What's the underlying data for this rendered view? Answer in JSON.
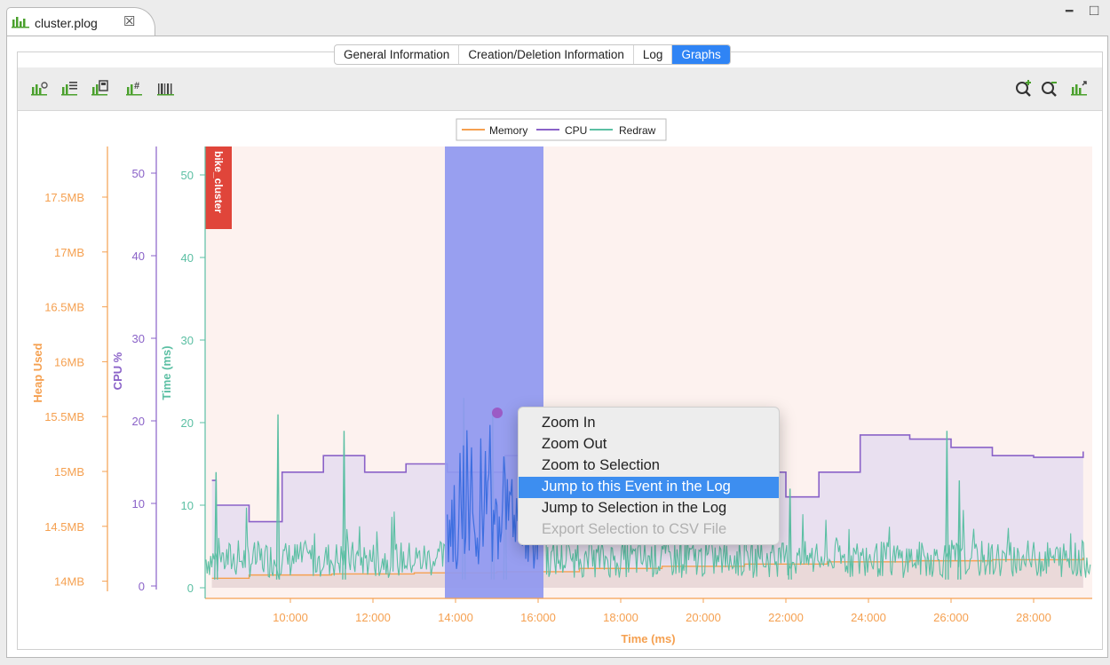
{
  "editor_tab": {
    "title": "cluster.plog",
    "close": "☒"
  },
  "window_controls": {
    "minimize": "━",
    "maximize": "□"
  },
  "view_tabs": [
    {
      "label": "General Information",
      "active": false
    },
    {
      "label": "Creation/Deletion Information",
      "active": false
    },
    {
      "label": "Log",
      "active": false
    },
    {
      "label": "Graphs",
      "active": true
    }
  ],
  "toolbar_left": [
    "chart-filter-icon",
    "chart-list-icon",
    "chart-film-icon",
    "chart-hash-icon",
    "chart-barcode-icon"
  ],
  "toolbar_right": [
    "zoom-in-icon",
    "zoom-out-icon",
    "chart-export-icon"
  ],
  "legend": [
    {
      "name": "Memory",
      "color": "#f5a050"
    },
    {
      "name": "CPU",
      "color": "#8a62c8"
    },
    {
      "name": "Redraw",
      "color": "#5bbfa3"
    }
  ],
  "axes": {
    "heap": {
      "label": "Heap Used",
      "color": "#f5a050",
      "ticks": [
        "17.5MB",
        "17MB",
        "16.5MB",
        "16MB",
        "15.5MB",
        "15MB",
        "14.5MB",
        "14MB"
      ]
    },
    "cpu": {
      "label": "CPU %",
      "color": "#8a62c8",
      "ticks": [
        "50",
        "40",
        "30",
        "20",
        "10",
        "0"
      ]
    },
    "time": {
      "label": "Time (ms)",
      "color": "#5bbfa3",
      "ticks": [
        "50",
        "40",
        "30",
        "20",
        "10",
        "0"
      ]
    },
    "x": {
      "label": "Time (ms)",
      "color": "#f5a050",
      "ticks": [
        "10:000",
        "12:000",
        "14:000",
        "16:000",
        "18:000",
        "20:000",
        "22:000",
        "24:000",
        "26:000",
        "28:000"
      ]
    }
  },
  "event_marker": {
    "label": "bike_cluster",
    "color": "#e0453a"
  },
  "chart_data": {
    "type": "line",
    "x_label": "Time (ms)",
    "x_ticks": [
      "10:000",
      "12:000",
      "14:000",
      "16:000",
      "18:000",
      "20:000",
      "22:000",
      "24:000",
      "26:000",
      "28:000"
    ],
    "series": [
      {
        "name": "CPU",
        "axis": "CPU %",
        "points": [
          [
            8100,
            13
          ],
          [
            8200,
            10
          ],
          [
            9000,
            8
          ],
          [
            9800,
            14
          ],
          [
            10800,
            16
          ],
          [
            11800,
            14
          ],
          [
            12800,
            15
          ],
          [
            13800,
            14
          ],
          [
            15200,
            16
          ],
          [
            16500,
            16
          ],
          [
            17500,
            15
          ],
          [
            18500,
            16
          ],
          [
            19500,
            15
          ],
          [
            20500,
            16
          ],
          [
            21200,
            14
          ],
          [
            22000,
            11
          ],
          [
            22800,
            14
          ],
          [
            23800,
            18.5
          ],
          [
            25000,
            18
          ],
          [
            26000,
            17
          ],
          [
            27000,
            16
          ],
          [
            28000,
            15.8
          ],
          [
            29200,
            16.5
          ]
        ]
      },
      {
        "name": "Memory",
        "axis": "Heap Used",
        "points": [
          [
            8100,
            14.03
          ],
          [
            9000,
            14.06
          ],
          [
            11000,
            14.07
          ],
          [
            13000,
            14.08
          ],
          [
            15000,
            14.09
          ],
          [
            17000,
            14.12
          ],
          [
            19000,
            14.14
          ],
          [
            21000,
            14.16
          ],
          [
            23000,
            14.18
          ],
          [
            25000,
            14.19
          ],
          [
            27000,
            14.2
          ],
          [
            29200,
            14.22
          ]
        ]
      },
      {
        "name": "Redraw",
        "axis": "Time (ms)",
        "peaks": [
          [
            8200,
            14
          ],
          [
            9700,
            21
          ],
          [
            11300,
            19
          ],
          [
            14200,
            23
          ],
          [
            14900,
            21
          ],
          [
            15200,
            16
          ],
          [
            22100,
            12
          ],
          [
            25900,
            19
          ],
          [
            26200,
            13
          ]
        ],
        "baseline_ms": 3
      }
    ],
    "selection": {
      "x_start": 13800,
      "x_end": 16200
    },
    "selected_point": {
      "x": 14900,
      "y": 21
    }
  },
  "context_menu": [
    {
      "label": "Zoom In",
      "state": "normal"
    },
    {
      "label": "Zoom Out",
      "state": "normal"
    },
    {
      "label": "Zoom to Selection",
      "state": "normal"
    },
    {
      "label": "Jump to this Event in the Log",
      "state": "selected"
    },
    {
      "label": "Jump to Selection in the Log",
      "state": "normal"
    },
    {
      "label": "Export Selection to CSV File",
      "state": "disabled"
    }
  ]
}
